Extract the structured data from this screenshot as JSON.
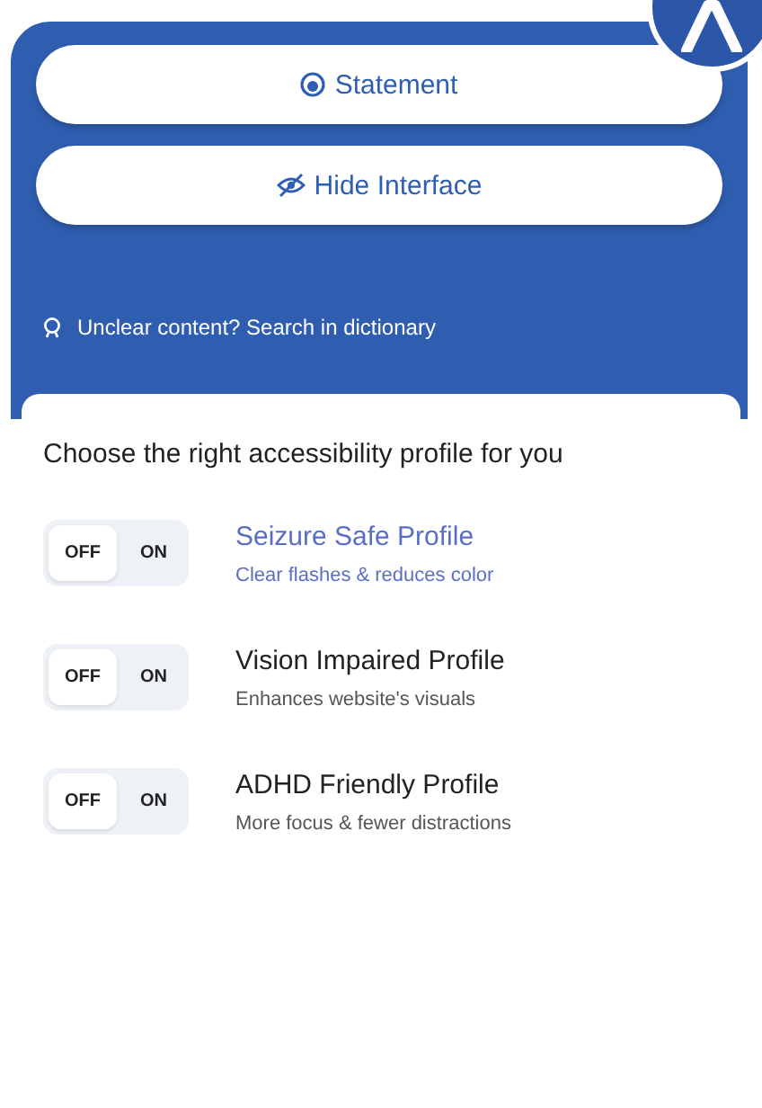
{
  "buttons": [
    {
      "kind": "statement",
      "label": "Statement"
    },
    {
      "kind": "hide",
      "label": "Hide Interface"
    }
  ],
  "dictionary_link": "Unclear content? Search in dictionary",
  "profiles_heading": "Choose the right accessibility profile for you",
  "profiles": [
    {
      "title": "Seizure Safe Profile",
      "description": "Clear flashes & reduces color",
      "on": false,
      "selected": true,
      "off_label": "OFF",
      "on_label": "ON"
    },
    {
      "title": "Vision Impaired Profile",
      "description": "Enhances website's visuals",
      "on": false,
      "selected": false,
      "off_label": "OFF",
      "on_label": "ON"
    },
    {
      "title": "ADHD Friendly Profile",
      "description": "More focus & fewer distractions",
      "on": false,
      "selected": false,
      "off_label": "OFF",
      "on_label": "ON"
    }
  ]
}
